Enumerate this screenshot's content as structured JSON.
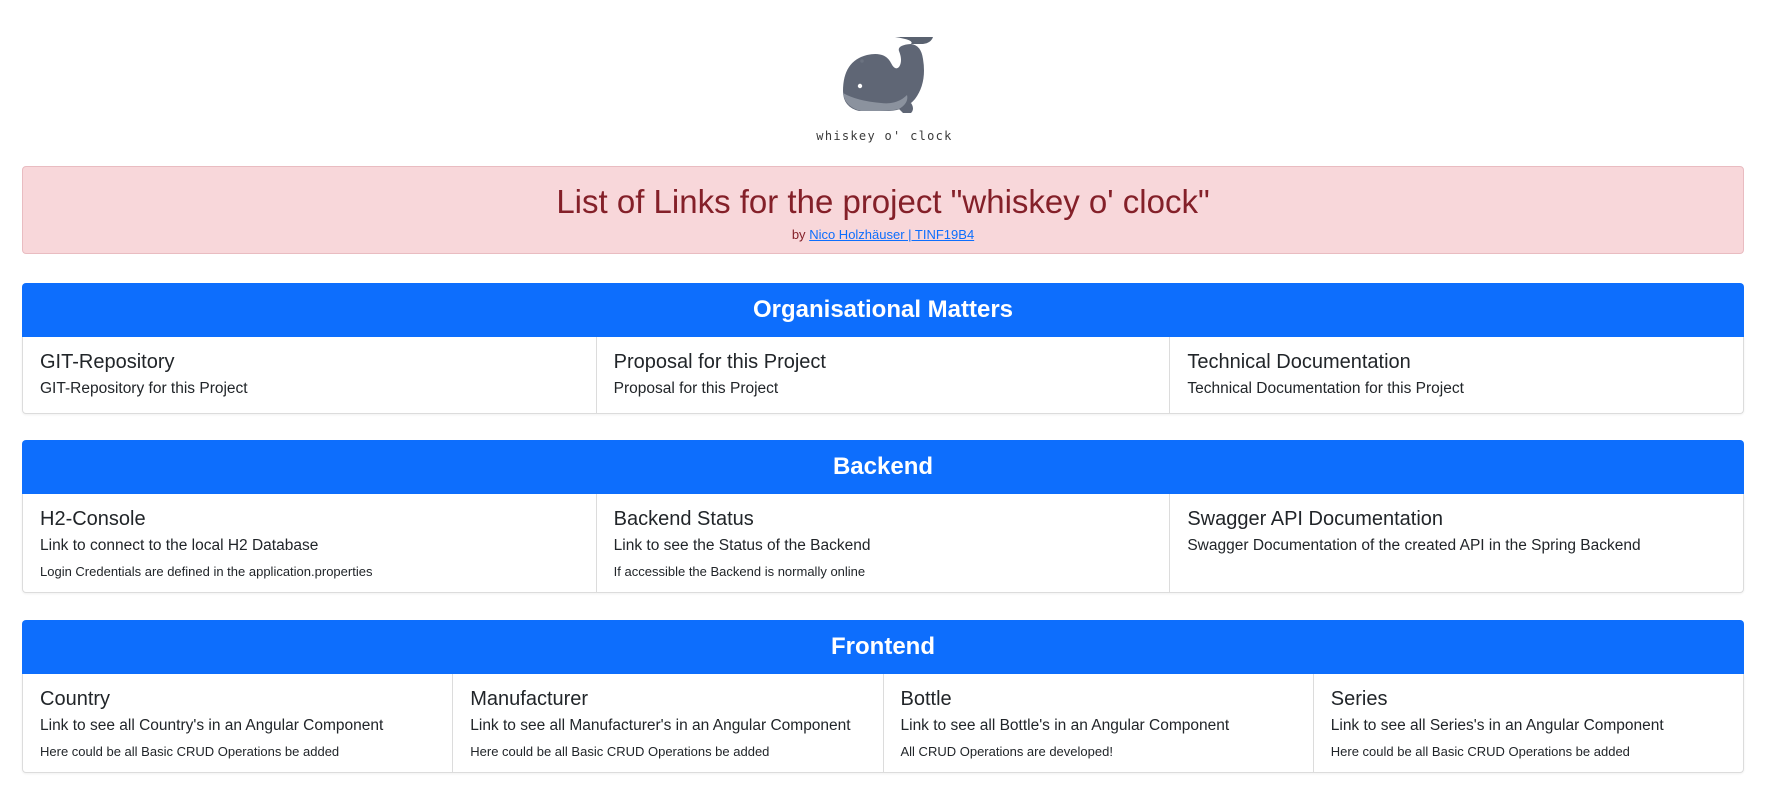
{
  "header": {
    "brand": "whiskey o' clock"
  },
  "alert": {
    "title": "List of Links for the project \"whiskey o' clock\"",
    "by": "by",
    "author_link": "Nico Holzhäuser | TINF19B4"
  },
  "sections": [
    {
      "title": "Organisational Matters",
      "cards": [
        {
          "title": "GIT-Repository",
          "text": "GIT-Repository for this Project",
          "note": ""
        },
        {
          "title": "Proposal for this Project",
          "text": "Proposal for this Project",
          "note": ""
        },
        {
          "title": "Technical Documentation",
          "text": "Technical Documentation for this Project",
          "note": ""
        }
      ]
    },
    {
      "title": "Backend",
      "cards": [
        {
          "title": "H2-Console",
          "text": "Link to connect to the local H2 Database",
          "note": "Login Credentials are defined in the application.properties"
        },
        {
          "title": "Backend Status",
          "text": "Link to see the Status of the Backend",
          "note": "If accessible the Backend is normally online"
        },
        {
          "title": "Swagger API Documentation",
          "text": "Swagger Documentation of the created API in the Spring Backend",
          "note": ""
        }
      ]
    },
    {
      "title": "Frontend",
      "cards": [
        {
          "title": "Country",
          "text": "Link to see all Country's in an Angular Component",
          "note": "Here could be all Basic CRUD Operations be added"
        },
        {
          "title": "Manufacturer",
          "text": "Link to see all Manufacturer's in an Angular Component",
          "note": "Here could be all Basic CRUD Operations be added"
        },
        {
          "title": "Bottle",
          "text": "Link to see all Bottle's in an Angular Component",
          "note": "All CRUD Operations are developed!"
        },
        {
          "title": "Series",
          "text": "Link to see all Series's in an Angular Component",
          "note": "Here could be all Basic CRUD Operations be added"
        }
      ]
    }
  ],
  "colors": {
    "primary": "#0d6efd",
    "alert_bg": "#f8d7da",
    "alert_text": "#842029"
  },
  "icons": {
    "logo": "whale-logo-icon"
  }
}
